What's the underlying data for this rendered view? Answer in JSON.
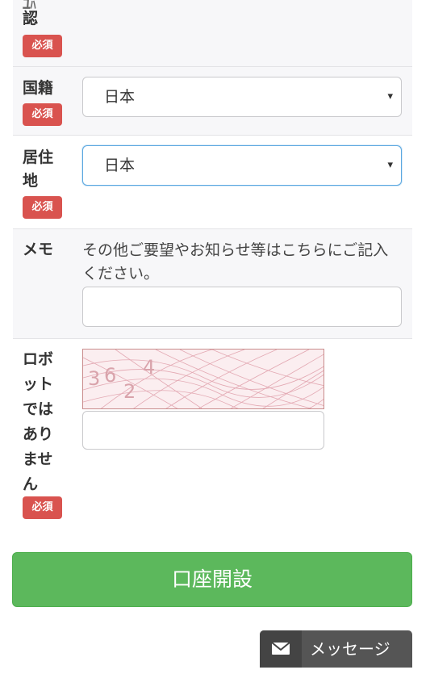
{
  "fields": {
    "confirm": {
      "label_partial": "認",
      "badge": "必須"
    },
    "nationality": {
      "label": "国籍",
      "badge": "必須",
      "value": "日本"
    },
    "residence": {
      "label_line1": "居住",
      "label_line2": "地",
      "badge": "必須",
      "value": "日本"
    },
    "memo": {
      "label": "メモ",
      "hint": "その他ご要望やお知らせ等はこちらにご記入ください。",
      "value": ""
    },
    "robot": {
      "label_lines": [
        "ロボ",
        "ット",
        "では",
        "あり",
        "ませ",
        "ん"
      ],
      "badge": "必須",
      "captcha_text": [
        "3",
        "6",
        "2",
        "4"
      ],
      "input_value": ""
    }
  },
  "submit_label": "口座開設",
  "message_button_label": "メッセージ",
  "icons": {
    "caret": "▾",
    "message": "envelope-icon"
  },
  "colors": {
    "required_badge": "#d9534f",
    "submit": "#5cb85c",
    "focus": "#5aa7e0"
  }
}
